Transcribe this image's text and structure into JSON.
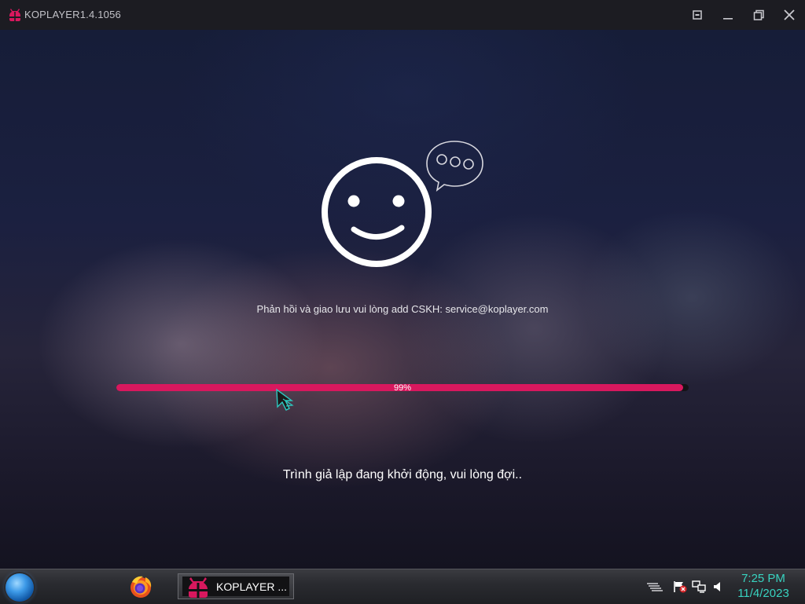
{
  "window": {
    "title": "KOPLAYER1.4.1056",
    "icons": [
      "koplayer-logo-icon",
      "screen-icon",
      "minimize-icon",
      "restore-icon",
      "close-icon"
    ]
  },
  "main": {
    "feedback_text": "Phản hồi và giao lưu vui lòng add CSKH: service@koplayer.com",
    "progress": {
      "value": 0.99,
      "label": "99%"
    },
    "status_text": "Trình giả lập đang khởi động, vui lòng đợi..",
    "colors": {
      "progress_fill": "#d8185e",
      "progress_track": "#141317"
    }
  },
  "taskbar": {
    "task_label": "KOPLAYER ...",
    "clock_time": "7:25 PM",
    "clock_date": "11/4/2023",
    "clock_color": "#38d3c0",
    "icons": [
      "start-orb-icon",
      "firefox-icon",
      "koplayer-task-icon",
      "tray-keyboard-icon",
      "tray-action-center-icon",
      "tray-network-icon",
      "tray-volume-icon"
    ]
  }
}
